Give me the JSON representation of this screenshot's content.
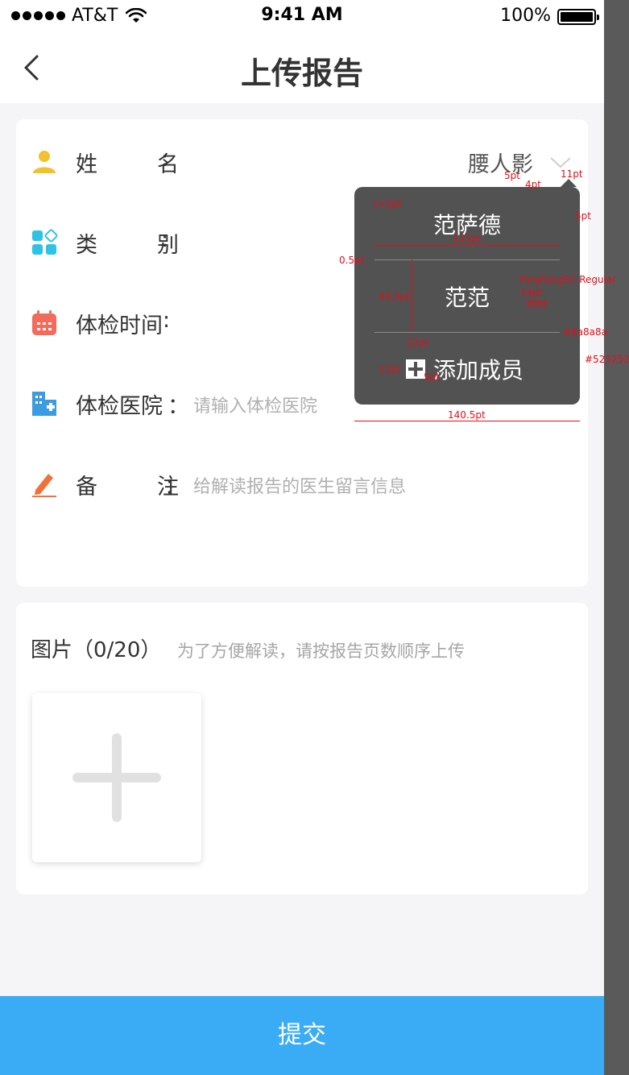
{
  "status_bar": {
    "carrier": "AT&T",
    "time": "9:41 AM",
    "battery": "100%"
  },
  "nav": {
    "title": "上传报告"
  },
  "form": {
    "name": {
      "label": "姓名",
      "colon": ":",
      "value": "腰人影"
    },
    "category": {
      "label": "类别",
      "colon": ":"
    },
    "exam_time": {
      "label": "体检时间",
      "colon": ":"
    },
    "hospital": {
      "label": "体检医院",
      "colon": "：",
      "placeholder": "请输入体检医院"
    },
    "remark": {
      "label": "备注",
      "colon": "：",
      "placeholder": "给解读报告的医生留言信息"
    }
  },
  "images": {
    "title": "图片（0/20）",
    "hint": "为了方便解读，请按报告页数顺序上传"
  },
  "submit": {
    "label": "提交"
  },
  "popover": {
    "items": [
      "范萨德",
      "范范"
    ],
    "add_label": "添加成员"
  },
  "annotations": {
    "radius": "r=5pt",
    "top_gap": "5pt",
    "arrow_height": "4pt",
    "arrow_offset": "11pt",
    "right_pad": "5pt",
    "inner_width": "115pt",
    "divider": "0.5pt",
    "row_height": "44.5pt",
    "font": "PingFangSC-Regular",
    "font_size": "14pt",
    "text_color": "ffffff",
    "divider_color": "#8a8a8a",
    "bg_color": "#525252",
    "icon_width": "12pt",
    "icon_height": "12pt",
    "icon_gap": "5pt",
    "total_width": "140.5pt"
  },
  "colors": {
    "accent": "#3aacf6",
    "popover_bg": "#525252",
    "divider": "#8a8a8a",
    "icon_user": "#f2c12e",
    "icon_category": "#2ec3e6",
    "icon_calendar": "#f26b5b",
    "icon_hospital": "#3b9de0",
    "icon_edit": "#f2703a"
  }
}
